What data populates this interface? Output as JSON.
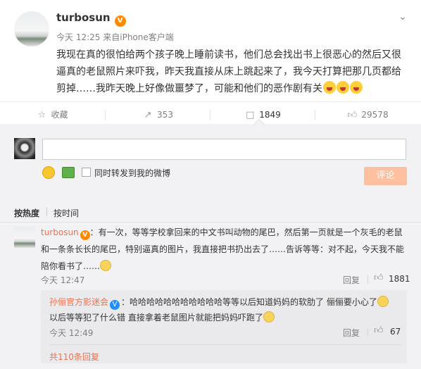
{
  "post": {
    "author": "turbosun",
    "time": "今天 12:25",
    "source_prefix": "来自",
    "source": "iPhone客户端",
    "text": "我现在真的很怕给两个孩子晚上睡前读书，他们总会找出书上很恶心的然后又很逼真的老鼠照片来吓我，昨天我直接从床上跳起来了，我今天打算把那几页都给剪掉……我昨天晚上好像做噩梦了，可能和他们的恶作剧有关"
  },
  "actions": {
    "favorite": "收藏",
    "repost": "353",
    "comment": "1849",
    "like": "29578"
  },
  "composer": {
    "placeholder": "",
    "also_repost": "同时转发到我的微博",
    "submit": "评论"
  },
  "sort": {
    "hot": "按热度",
    "time": "按时间"
  },
  "comment": {
    "author": "turbosun",
    "text": "：有一次，等等学校拿回来的中文书叫动物的尾巴，然后第一页就是一个灰毛的老鼠和一条条长长的尾巴，特别逼真的图片，我直接把书扔出去了……告诉等等：对不起，今天我不能陪你看书了……",
    "time": "今天 12:47",
    "reply": "回复",
    "likes": "1881"
  },
  "reply": {
    "author": "孙俪官方影迷会",
    "text": "哈哈哈哈哈哈哈哈哈哈哈等等以后知道妈妈的软肋了 俪俪要小心了",
    "text2": "以后等等犯了什么错 直接拿着老鼠图片就能把妈妈吓跑了",
    "time": "今天 12:49",
    "reply": "回复",
    "likes": "67"
  },
  "more_replies": "共110条回复",
  "icons": {
    "menu": "chevron-down-icon",
    "favorite": "bookmark-icon",
    "repost": "repost-icon",
    "comment": "comment-icon",
    "like": "thumb-up-icon"
  },
  "colors": {
    "accent": "#eb7350",
    "submit_disabled": "#ffc09f",
    "vip": "#ff8a00"
  }
}
